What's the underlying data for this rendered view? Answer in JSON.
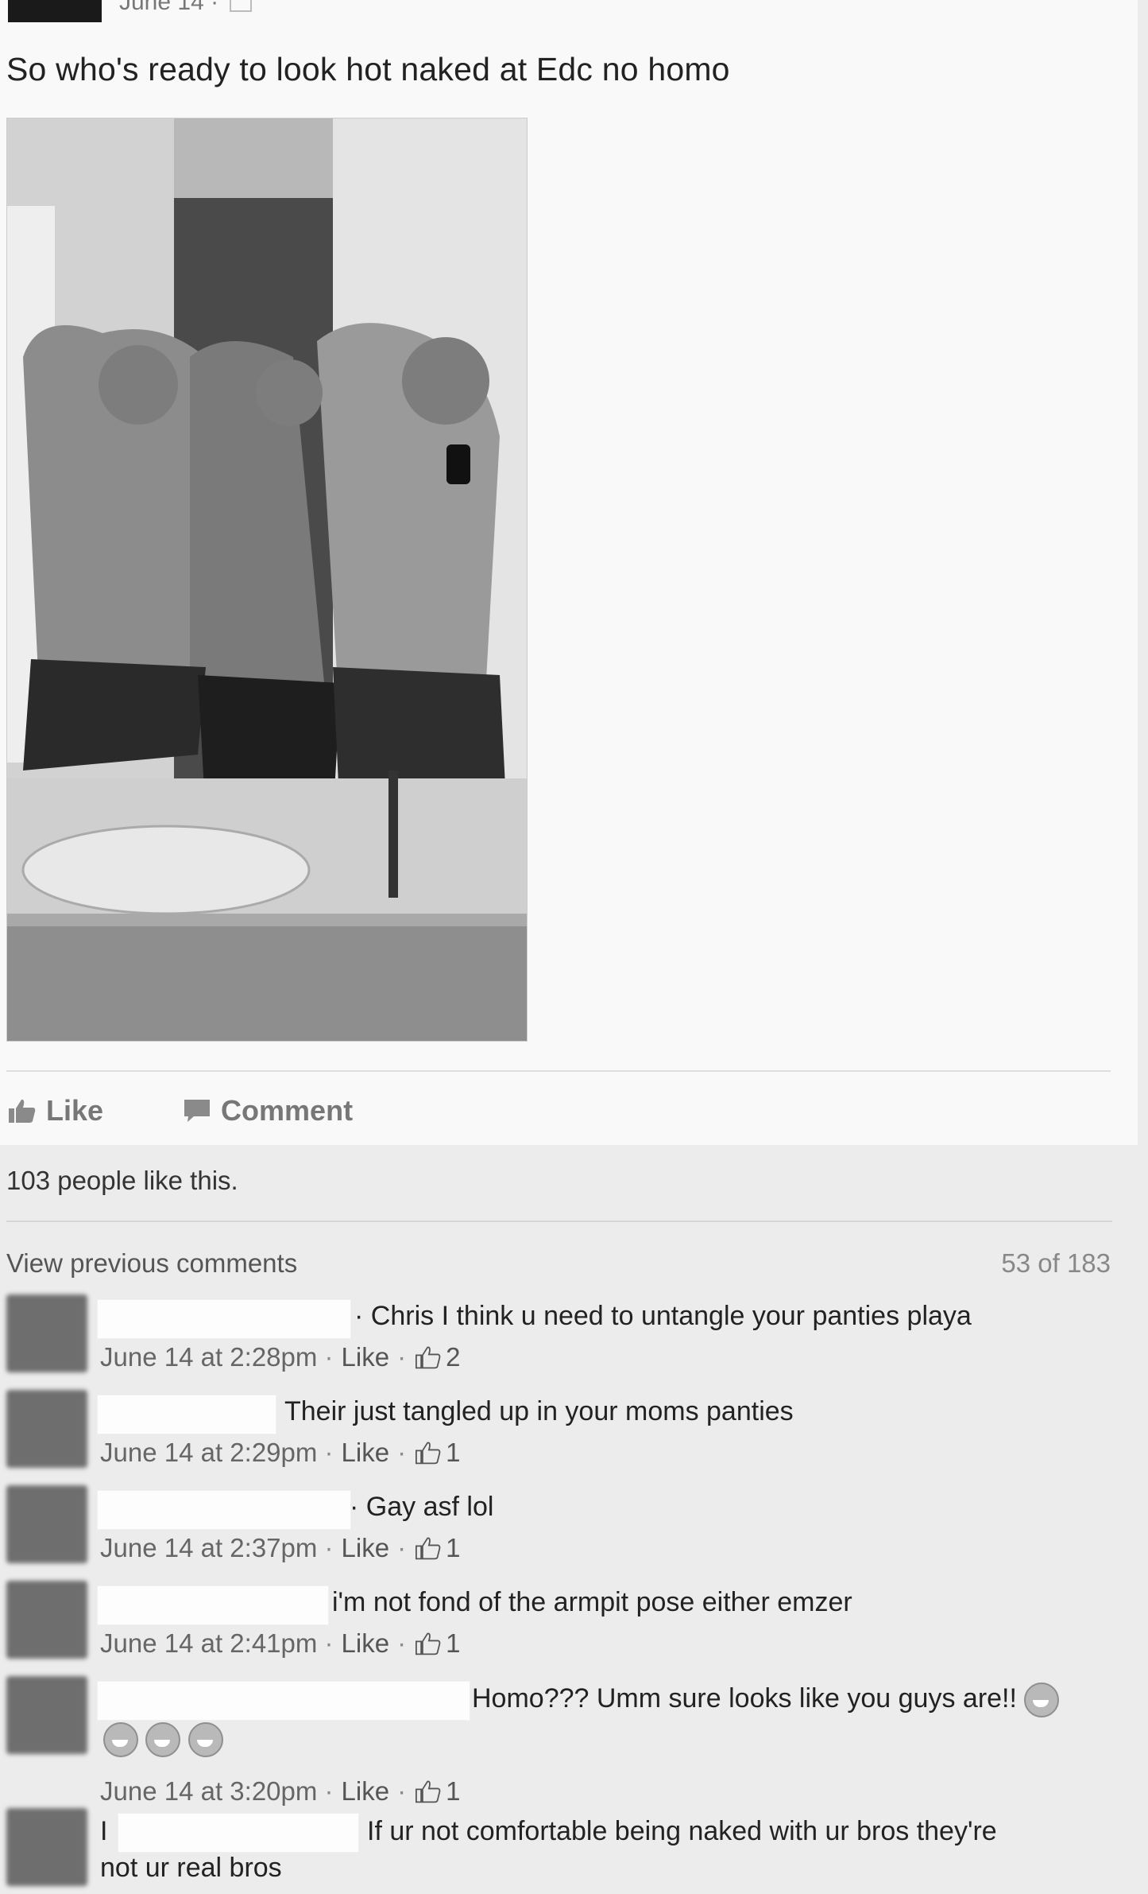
{
  "post": {
    "date": "June 14 ·",
    "text": "So who's ready to look hot naked at Edc no homo"
  },
  "actions": {
    "like": "Like",
    "comment": "Comment"
  },
  "likes_summary": "103 people like this.",
  "view_previous": "View previous comments",
  "comment_count": "53 of 183",
  "comments": [
    {
      "text": "Chris I think u need to untangle your panties playa",
      "time": "June 14 at 2:28pm",
      "like": "Like",
      "likes": "2"
    },
    {
      "text": "Their just tangled up in your moms panties",
      "time": "June 14 at 2:29pm",
      "like": "Like",
      "likes": "1"
    },
    {
      "text": "Gay asf lol",
      "time": "June 14 at 2:37pm",
      "like": "Like",
      "likes": "1"
    },
    {
      "text": "i'm not fond of the armpit pose either emzer",
      "time": "June 14 at 2:41pm",
      "like": "Like",
      "likes": "1"
    },
    {
      "text": "Homo??? Umm sure looks like you guys are!!",
      "time": "June 14 at 3:20pm",
      "like": "Like",
      "likes": "1"
    },
    {
      "text_prefix": "I",
      "text": "If ur not comfortable being naked with ur bros they're",
      "text_line2": "not ur real bros"
    }
  ],
  "icons": [
    "photo-icon",
    "thumbs-up-icon",
    "comment-bubble-icon",
    "grinning-emoji-icon"
  ]
}
